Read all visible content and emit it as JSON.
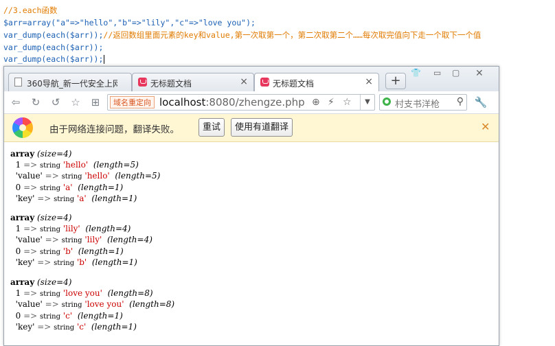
{
  "editor": {
    "lines": [
      {
        "parts": [
          {
            "t": "//3.each函数",
            "c": "c-comment"
          }
        ]
      },
      {
        "parts": [
          {
            "t": "$arr=array(\"a\"=>\"hello\",\"b\"=>\"lily\",\"c\"=>\"love you\");",
            "c": "c-var"
          }
        ]
      },
      {
        "parts": [
          {
            "t": "var_dump(each($arr));",
            "c": "c-fn"
          },
          {
            "t": "//返回数组里面元素的key和value,第一次取第一个，第二次取第二个……每次取完值向下走一个取下一个值",
            "c": "c-comment"
          }
        ]
      },
      {
        "parts": [
          {
            "t": "var_dump(each($arr));",
            "c": "c-fn"
          }
        ]
      },
      {
        "parts": [
          {
            "t": "var_dump(each($arr));",
            "c": "c-fn"
          }
        ]
      }
    ]
  },
  "browser": {
    "tabs": [
      {
        "label": "360导航_新一代安全上网",
        "icon": "page-icon",
        "active": false
      },
      {
        "label": "无标题文档",
        "icon": "red-page-icon",
        "active": false
      },
      {
        "label": "无标题文档",
        "icon": "red-page-icon",
        "active": true
      }
    ],
    "new_tab_label": "+",
    "toolbar": {
      "redirect_badge": "域名重定向",
      "url_host": "localhost",
      "url_rest": ":8080/zhengze.php",
      "search_placeholder": "村支书洋枪"
    },
    "translate_bar": {
      "message": "由于网络连接问题，翻译失败。",
      "retry_label": "重试",
      "youdao_label": "使用有道翻译",
      "close_label": "✕"
    }
  },
  "dumps": [
    {
      "size": "4",
      "entries": [
        {
          "key": "1",
          "isstr": false,
          "val": "'hello'",
          "len": "5"
        },
        {
          "key": "'value'",
          "isstr": true,
          "val": "'hello'",
          "len": "5"
        },
        {
          "key": "0",
          "isstr": false,
          "val": "'a'",
          "len": "1"
        },
        {
          "key": "'key'",
          "isstr": true,
          "val": "'a'",
          "len": "1"
        }
      ]
    },
    {
      "size": "4",
      "entries": [
        {
          "key": "1",
          "isstr": false,
          "val": "'lily'",
          "len": "4"
        },
        {
          "key": "'value'",
          "isstr": true,
          "val": "'lily'",
          "len": "4"
        },
        {
          "key": "0",
          "isstr": false,
          "val": "'b'",
          "len": "1"
        },
        {
          "key": "'key'",
          "isstr": true,
          "val": "'b'",
          "len": "1"
        }
      ]
    },
    {
      "size": "4",
      "entries": [
        {
          "key": "1",
          "isstr": false,
          "val": "'love you'",
          "len": "8"
        },
        {
          "key": "'value'",
          "isstr": true,
          "val": "'love you'",
          "len": "8"
        },
        {
          "key": "0",
          "isstr": false,
          "val": "'c'",
          "len": "1"
        },
        {
          "key": "'key'",
          "isstr": true,
          "val": "'c'",
          "len": "1"
        }
      ]
    }
  ]
}
